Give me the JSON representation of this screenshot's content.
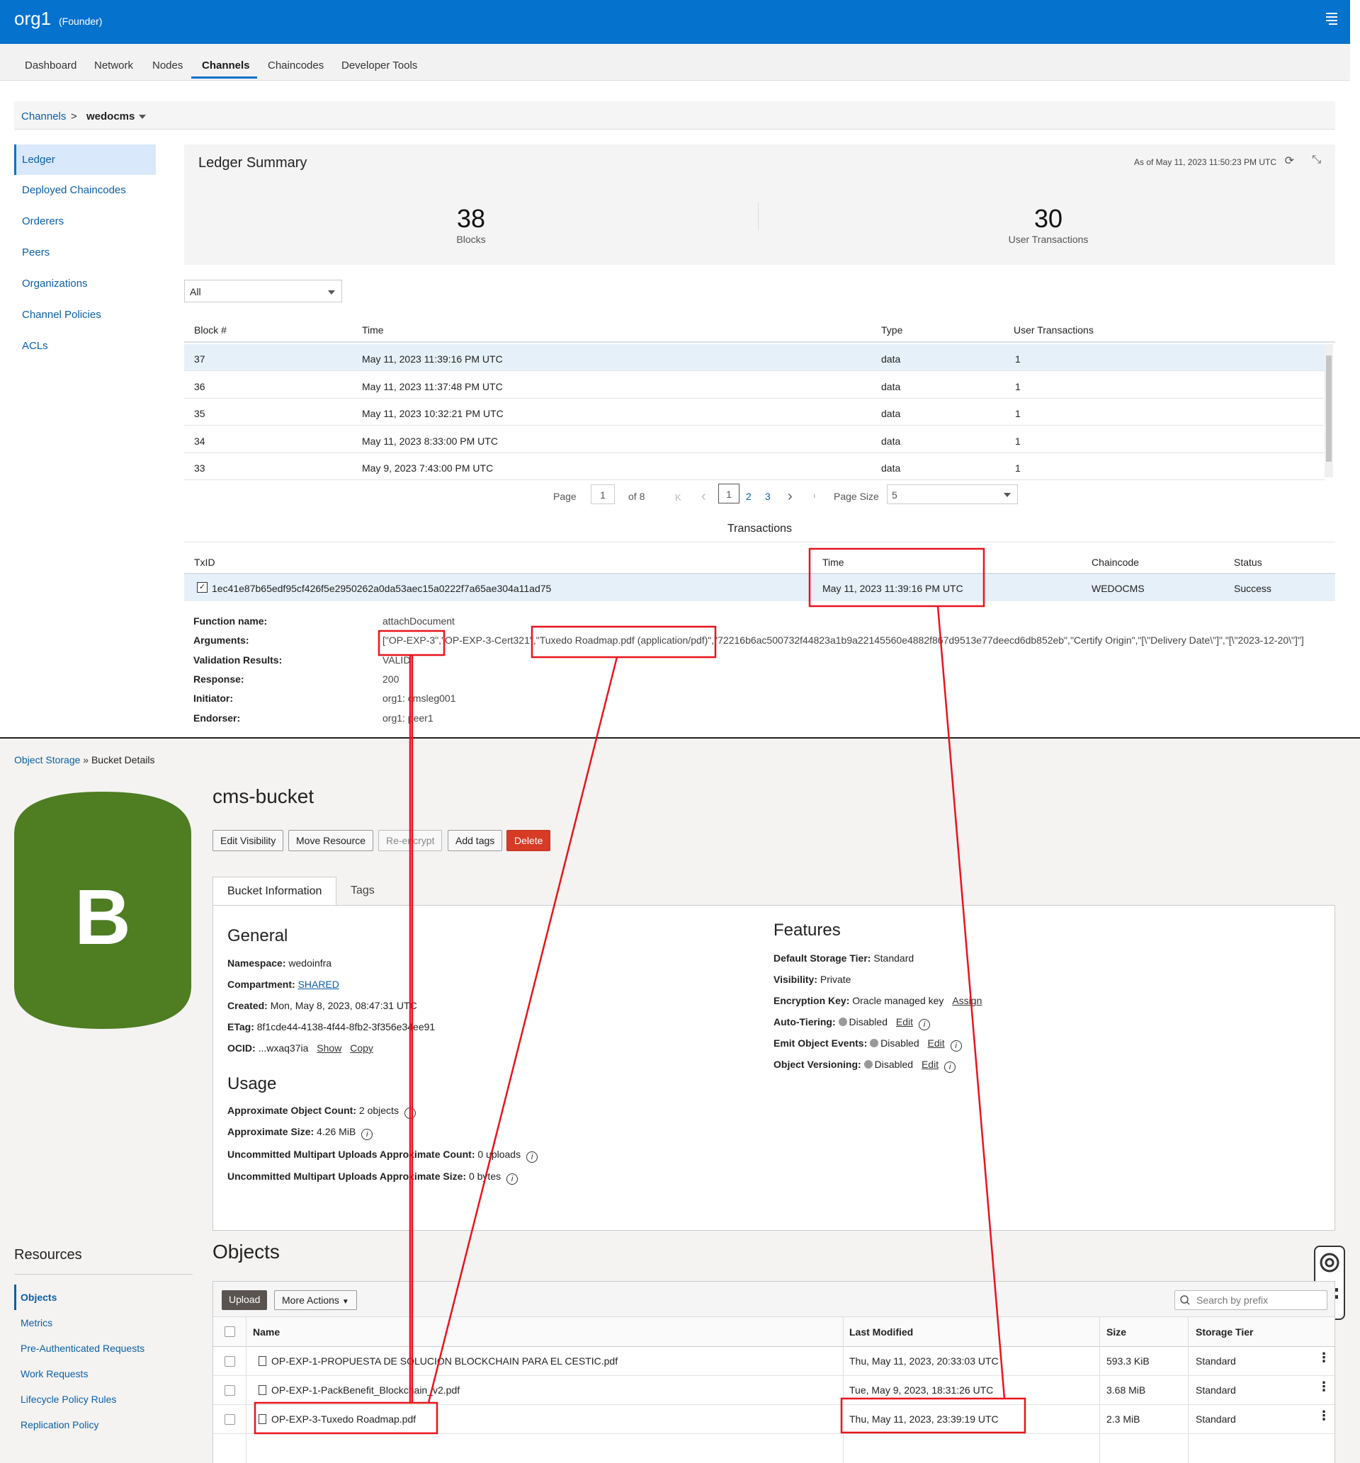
{
  "top": {
    "org": "org1",
    "role": "(Founder)",
    "tabs": [
      "Dashboard",
      "Network",
      "Nodes",
      "Channels",
      "Chaincodes",
      "Developer Tools"
    ],
    "breadcrumb": {
      "root": "Channels",
      "sep": ">",
      "current": "wedocms"
    },
    "left_nav": [
      "Ledger",
      "Deployed Chaincodes",
      "Orderers",
      "Peers",
      "Organizations",
      "Channel Policies",
      "ACLs"
    ],
    "summary": {
      "title": "Ledger Summary",
      "as_of": "As of May 11, 2023 11:50:23 PM UTC",
      "blocks": "38",
      "blocks_label": "Blocks",
      "user_tx": "30",
      "user_tx_label": "User Transactions"
    },
    "filter_value": "All",
    "block_headers": [
      "Block #",
      "Time",
      "Type",
      "User Transactions"
    ],
    "blocks": [
      [
        "37",
        "May 11, 2023 11:39:16 PM UTC",
        "data",
        "1"
      ],
      [
        "36",
        "May 11, 2023 11:37:48 PM UTC",
        "data",
        "1"
      ],
      [
        "35",
        "May 11, 2023 10:32:21 PM UTC",
        "data",
        "1"
      ],
      [
        "34",
        "May 11, 2023 8:33:00 PM UTC",
        "data",
        "1"
      ],
      [
        "33",
        "May 9, 2023 7:43:00 PM UTC",
        "data",
        "1"
      ]
    ],
    "pager": {
      "page_label": "Page",
      "page": "1",
      "of": "of 8",
      "pages": [
        "1",
        "2",
        "3"
      ],
      "first": "K",
      "prev": "‹",
      "next": "›",
      "last": "ᛌ",
      "size_label": "Page Size",
      "size": "5"
    },
    "tx_title": "Transactions",
    "tx_headers": [
      "TxID",
      "Time",
      "Chaincode",
      "Status"
    ],
    "tx": {
      "id": "1ec41e87b65edf95cf426f5e2950262a0da53aec15a0222f7a65ae304a11ad75",
      "time": "May 11, 2023 11:39:16 PM UTC",
      "chaincode": "WEDOCMS",
      "status": "Success"
    },
    "details": [
      {
        "label": "Function name:",
        "value": "attachDocument"
      },
      {
        "label": "Arguments:",
        "value": "[\"OP-EXP-3\",\"OP-EXP-3-Cert321\",\"Tuxedo Roadmap.pdf (application/pdf)\",\"72216b6ac500732f44823a1b9a22145560e4882f867d9513e77deecd6db852eb\",\"Certify Origin\",\"[\\\"Delivery Date\\\"]\",\"[\\\"2023-12-20\\\"]\"]"
      },
      {
        "label": "Validation Results:",
        "value": "VALID"
      },
      {
        "label": "Response:",
        "value": "200"
      },
      {
        "label": "Initiator:",
        "value": "org1: cmsleg001"
      },
      {
        "label": "Endorser:",
        "value": "org1: peer1"
      }
    ]
  },
  "bottom": {
    "breadcrumb": {
      "root": "Object Storage",
      "sep": "»",
      "current": "Bucket Details"
    },
    "bucket_letter": "B",
    "bucket_name": "cms-bucket",
    "actions": [
      "Edit Visibility",
      "Move Resource",
      "Re-encrypt",
      "Add tags",
      "Delete"
    ],
    "subtabs": [
      "Bucket Information",
      "Tags"
    ],
    "general_title": "General",
    "general": {
      "namespace_label": "Namespace:",
      "namespace": "wedoinfra",
      "compartment_label": "Compartment:",
      "compartment": "SHARED",
      "created_label": "Created:",
      "created": "Mon, May 8, 2023, 08:47:31 UTC",
      "etag_label": "ETag:",
      "etag": "8f1cde44-4138-4f44-8fb2-3f356e34ee91",
      "ocid_label": "OCID:",
      "ocid": "...wxaq37ia",
      "show": "Show",
      "copy": "Copy"
    },
    "usage_title": "Usage",
    "usage": {
      "count_label": "Approximate Object Count:",
      "count": "2 objects",
      "size_label": "Approximate Size:",
      "size": "4.26 MiB",
      "mp_count_label": "Uncommitted Multipart Uploads Approximate Count:",
      "mp_count": "0 uploads",
      "mp_size_label": "Uncommitted Multipart Uploads Approximate Size:",
      "mp_size": "0 bytes"
    },
    "features_title": "Features",
    "features": {
      "tier_label": "Default Storage Tier:",
      "tier": "Standard",
      "vis_label": "Visibility:",
      "vis": "Private",
      "enc_label": "Encryption Key:",
      "enc": "Oracle managed key",
      "assign": "Assign",
      "auto_label": "Auto-Tiering:",
      "auto": "Disabled",
      "emit_label": "Emit Object Events:",
      "emit": "Disabled",
      "ver_label": "Object Versioning:",
      "ver": "Disabled",
      "edit": "Edit"
    },
    "resources_title": "Resources",
    "resources": [
      "Objects",
      "Metrics",
      "Pre-Authenticated Requests",
      "Work Requests",
      "Lifecycle Policy Rules",
      "Replication Policy"
    ],
    "objects_title": "Objects",
    "upload": "Upload",
    "more_actions": "More Actions",
    "search_placeholder": "Search by prefix",
    "obj_headers": [
      "Name",
      "Last Modified",
      "Size",
      "Storage Tier"
    ],
    "objects": [
      [
        "OP-EXP-1-PROPUESTA DE SOLUCION BLOCKCHAIN PARA EL CESTIC.pdf",
        "Thu, May 11, 2023, 20:33:03 UTC",
        "593.3 KiB",
        "Standard"
      ],
      [
        "OP-EXP-1-PackBenefit_Blockchain_v2.pdf",
        "Tue, May 9, 2023, 18:31:26 UTC",
        "3.68 MiB",
        "Standard"
      ],
      [
        "OP-EXP-3-Tuxedo Roadmap.pdf",
        "Thu, May 11, 2023, 23:39:19 UTC",
        "2.3 MiB",
        "Standard"
      ]
    ]
  },
  "colors": {
    "header_blue": "#0572ce",
    "bucket_green": "#4e7d22",
    "annotation_red": "#e8141c",
    "delete_red": "#d63b25"
  }
}
